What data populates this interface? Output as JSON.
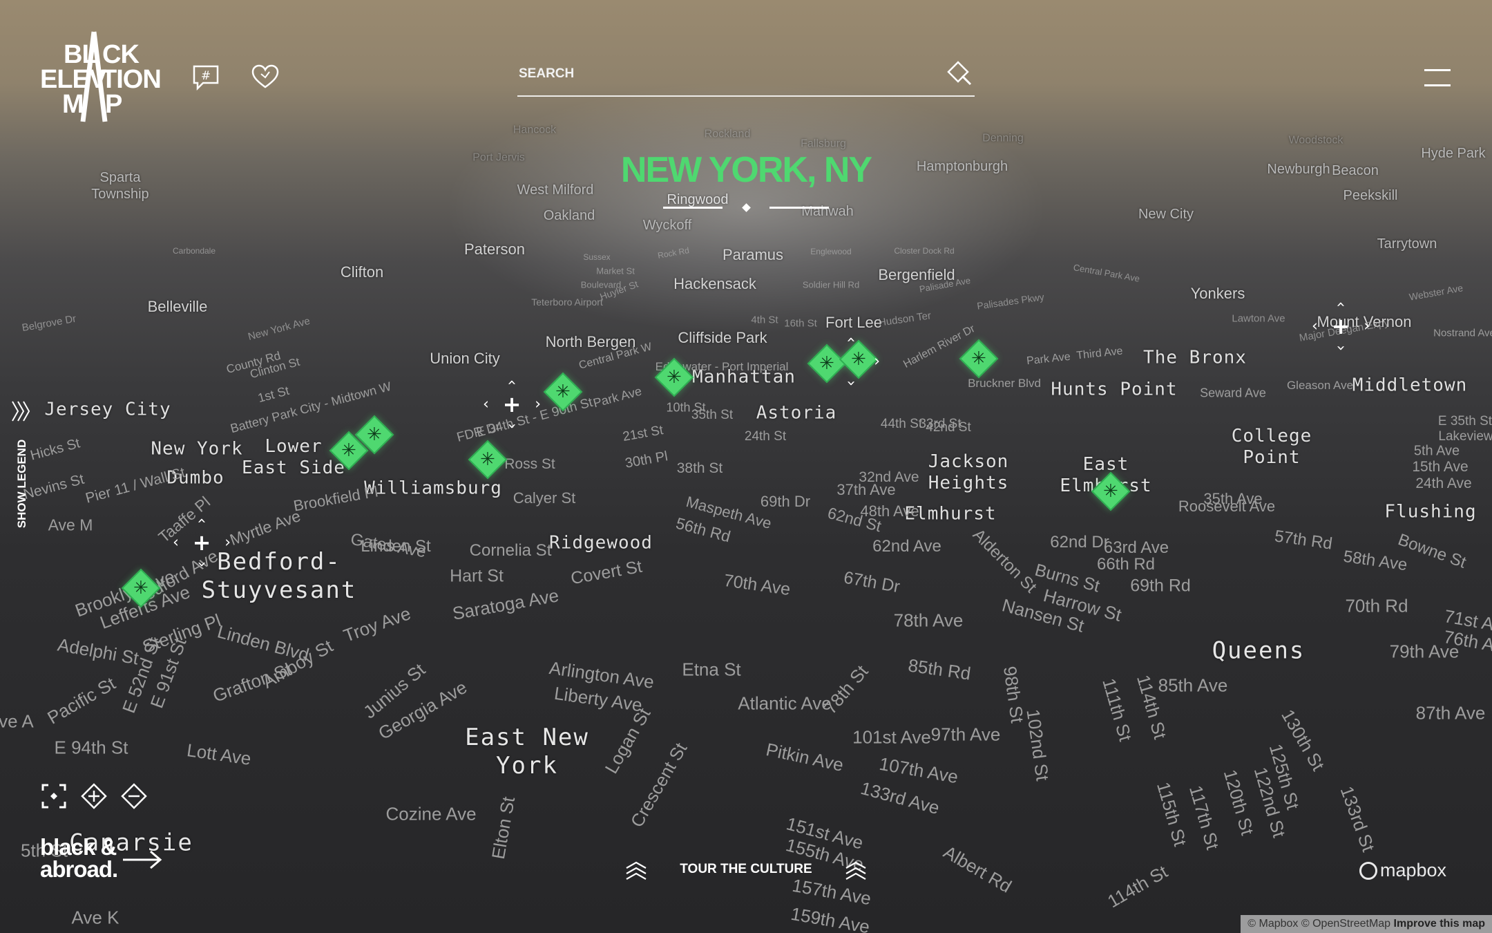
{
  "app": {
    "logo_words": [
      "BL",
      "CK",
      "ELEV",
      "TION",
      "M",
      "P"
    ],
    "brand_line1": "black &",
    "brand_line2": "abroad.",
    "hashtag_icon": "hashtag-chat-icon",
    "favorites_icon": "heart-icon"
  },
  "search": {
    "placeholder": "SEARCH",
    "value": ""
  },
  "city": {
    "title": "NEW YORK, NY",
    "subtitle": "Ringwood"
  },
  "legend": {
    "label": "SHOW LEGEND"
  },
  "tour": {
    "label": "TOUR THE CULTURE"
  },
  "attribution": {
    "mapbox_logo": "mapbox",
    "copyright_mapbox": "© Mapbox",
    "copyright_osm": "© OpenStreetMap",
    "improve": "Improve this map"
  },
  "colors": {
    "accent": "#4fd870",
    "text": "#ffffff"
  },
  "places": [
    {
      "text": "Sparta Township",
      "cls": "s"
    },
    {
      "text": "Hancock",
      "cls": "f"
    },
    {
      "text": "Port Jervis",
      "cls": "f"
    },
    {
      "text": "Rockland",
      "cls": "f"
    },
    {
      "text": "Fallsburg",
      "cls": "f"
    },
    {
      "text": "Denning",
      "cls": "f"
    },
    {
      "text": "Woodstock",
      "cls": "f"
    },
    {
      "text": "Hyde Park",
      "cls": "s"
    },
    {
      "text": "Newburgh",
      "cls": "s"
    },
    {
      "text": "Beacon",
      "cls": "s"
    },
    {
      "text": "Peekskill",
      "cls": "s"
    },
    {
      "text": "Hamptonburgh",
      "cls": "s"
    },
    {
      "text": "West Milford",
      "cls": "s"
    },
    {
      "text": "Oakland",
      "cls": "s"
    },
    {
      "text": "Wyckoff",
      "cls": "s"
    },
    {
      "text": "Mahwah",
      "cls": "s"
    },
    {
      "text": "New City",
      "cls": "s"
    },
    {
      "text": "Tarrytown",
      "cls": "s"
    },
    {
      "text": "Paterson",
      "cls": "m"
    },
    {
      "text": "Paramus",
      "cls": "m"
    },
    {
      "text": "Clifton",
      "cls": "m"
    },
    {
      "text": "Hackensack",
      "cls": "m"
    },
    {
      "text": "Bergenfield",
      "cls": "m"
    },
    {
      "text": "Yonkers",
      "cls": "m"
    },
    {
      "text": "Belleville",
      "cls": "m"
    },
    {
      "text": "Mount Vernon",
      "cls": "m"
    },
    {
      "text": "Fort Lee",
      "cls": "m"
    },
    {
      "text": "North Bergen",
      "cls": "m"
    },
    {
      "text": "Cliffside Park",
      "cls": "m"
    },
    {
      "text": "Union City",
      "cls": "m"
    },
    {
      "text": "The Bronx",
      "cls": "l"
    },
    {
      "text": "Hunts Point",
      "cls": "l"
    },
    {
      "text": "Middletown",
      "cls": "l"
    },
    {
      "text": "Manhattan",
      "cls": "l"
    },
    {
      "text": "Astoria",
      "cls": "l"
    },
    {
      "text": "Jersey City",
      "cls": "l"
    },
    {
      "text": "College Point",
      "cls": "l"
    },
    {
      "text": "New York",
      "cls": "l"
    },
    {
      "text": "Lower East Side",
      "cls": "l"
    },
    {
      "text": "Dumbo",
      "cls": "l"
    },
    {
      "text": "Williamsburg",
      "cls": "l"
    },
    {
      "text": "Jackson Heights",
      "cls": "l"
    },
    {
      "text": "East Elmhurst",
      "cls": "l"
    },
    {
      "text": "Elmhurst",
      "cls": "l"
    },
    {
      "text": "Flushing",
      "cls": "l"
    },
    {
      "text": "Ridgewood",
      "cls": "l"
    },
    {
      "text": "Bedford-Stuyvesant",
      "cls": "xl"
    },
    {
      "text": "Queens",
      "cls": "xl"
    },
    {
      "text": "East New York",
      "cls": "xl"
    },
    {
      "text": "Canarsie",
      "cls": "xl"
    }
  ],
  "streets": [
    "Hudson Ter",
    "Palisades Pkwy",
    "Park Ave",
    "Third Ave",
    "Harlem River Dr",
    "Bruckner Blvd",
    "Seward Ave",
    "Gleason Ave",
    "5th Ave",
    "15th Ave",
    "24th Ave",
    "35th Ave",
    "Roosevelt Ave",
    "57th Rd",
    "58th Ave",
    "Bowne St",
    "70th Rd",
    "79th Ave",
    "87th Ave",
    "71st Ave",
    "76th Ave",
    "62nd Dr",
    "63rd Ave",
    "66th Rd",
    "69th Rd",
    "Burns St",
    "Harrow St",
    "Nansen St",
    "Alderton St",
    "62nd Ave",
    "67th Dr",
    "70th Ave",
    "78th Ave",
    "85th Rd",
    "85th Ave",
    "98th St",
    "102nd St",
    "111th St",
    "114th St",
    "130th St",
    "125th St",
    "115th St",
    "117th St",
    "120th St",
    "122nd St",
    "133rd St",
    "97th Ave",
    "101st Ave",
    "107th Ave",
    "133rd Ave",
    "151st Ave",
    "155th Ave",
    "157th Ave",
    "159th Ave",
    "114th St",
    "Albert Rd",
    "Pitkin Ave",
    "Atlantic Ave",
    "78th St",
    "Etna St",
    "Liberty Ave",
    "Arlington Ave",
    "Logan St",
    "Crescent St",
    "Elton St",
    "Cozine Ave",
    "Georgia Ave",
    "Junius St",
    "Amboy St",
    "Grafton St",
    "Lott Ave",
    "Linden Blvd",
    "Sterling Pl",
    "Troy Ave",
    "Saratoga Ave",
    "Covert St",
    "Cornelia St",
    "Hart St",
    "Linden St",
    "Gates Ave",
    "Myrtle Ave",
    "Taaffe Pl",
    "Adelphi St",
    "Lefferts Ave",
    "Brooklyn Ave",
    "Bedford Ave",
    "Pacific St",
    "E 52nd St",
    "E 91st St",
    "E 94th St",
    "Ave A",
    "5th St",
    "Ave K",
    "Ave M",
    "Nevins St",
    "Pier 11 / Wall St",
    "Hicks St",
    "Brookfield Pl",
    "Ross St",
    "Calyer St",
    "Maspeth Ave",
    "56th Rd",
    "69th Dr",
    "62nd St",
    "48th Ave",
    "37th Ave",
    "32nd Ave",
    "44th St",
    "33rd St",
    "42nd St",
    "24th St",
    "35th St",
    "38th St",
    "30th Pl",
    "21st St",
    "10th St",
    "FDR Dr",
    "E 34th St - E 90th St",
    "Park Ave",
    "Central Park W",
    "Edgewater - Port Imperial",
    "4th St",
    "16th St",
    "Battery Park City - Midtown W",
    "1st St",
    "Clinton St",
    "New York Ave",
    "County Rd",
    "Belgrove Dr",
    "Englewood",
    "Palisade Ave",
    "Soldier Hill Rd",
    "Closter Dock Rd",
    "Central Park Ave",
    "Webster Ave",
    "Major Deegan Expy",
    "Lawton Ave",
    "E 35th St",
    "Lakeview",
    "Carbondale",
    "Sussex",
    "Rock Rd",
    "Market St",
    "Boulevard",
    "Teterboro Airport",
    "Huyler St",
    "Nostrand Ave"
  ]
}
